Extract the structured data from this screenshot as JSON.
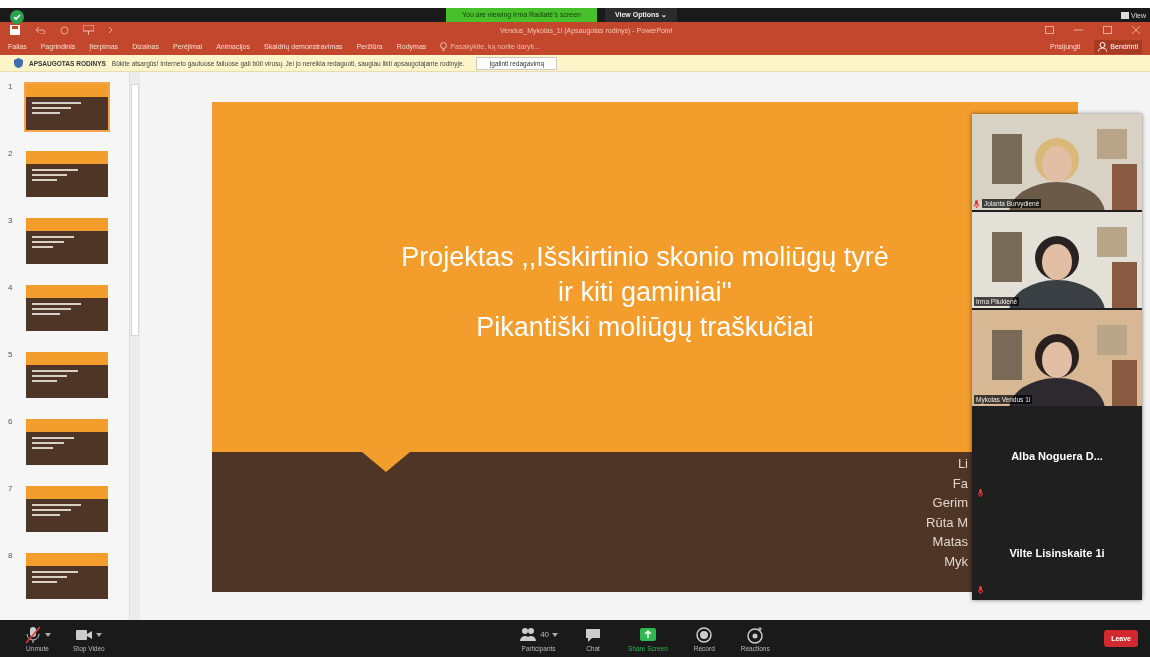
{
  "zoom_top": {
    "banner": "You are viewing Irma Radiatė's screen",
    "view_options": "View Options ⌄",
    "view": "View"
  },
  "window": {
    "title": "Vendus_Mykolas_1i (Apsaugotas rodinys) - PowerPoint"
  },
  "ribbon": {
    "tabs": [
      "Failas",
      "Pagrindinis",
      "Įterpimas",
      "Dizainas",
      "Perėjimai",
      "Animacijos",
      "Skaidrių demonstravimas",
      "Peržiūra",
      "Rodymas"
    ],
    "tell_me": "Pasakykite, ką norite daryti...",
    "sign_in": "Prisijungti",
    "share": "Bendrinti"
  },
  "protected_view": {
    "label": "APSAUGOTAS RODINYS",
    "message": "Būkite atsargūs! Interneto gautuose failuose gali būti virusų. Jei jo nereikia redaguoti, saugiau likti apsaugotajame rodinyje.",
    "button": "Įgalinti redagavimą"
  },
  "slides": [
    {
      "number": "1",
      "selected": true
    },
    {
      "number": "2",
      "selected": false
    },
    {
      "number": "3",
      "selected": false
    },
    {
      "number": "4",
      "selected": false
    },
    {
      "number": "5",
      "selected": false
    },
    {
      "number": "6",
      "selected": false
    },
    {
      "number": "7",
      "selected": false
    },
    {
      "number": "8",
      "selected": false
    }
  ],
  "current_slide": {
    "title_lines": [
      "Projektas ,,Išskirtinio skonio moliūgų tyrė",
      "ir kiti gaminiai''",
      "Pikantiški moliūgų traškučiai"
    ],
    "authors": [
      "Li",
      "Fa",
      "Gerim",
      "Rūta M",
      "Matas",
      "Myk"
    ]
  },
  "participants": [
    {
      "name": "Jolanta Burvydienė",
      "kind": "video",
      "muted": true
    },
    {
      "name": "Irma Pilukienė",
      "kind": "video",
      "muted": false
    },
    {
      "name": "Mykolas Vendus 1i",
      "kind": "video",
      "muted": false
    },
    {
      "name": "Alba Noguera D...",
      "kind": "name",
      "muted": true
    },
    {
      "name": "Vilte Lisinskaite 1i",
      "kind": "name",
      "muted": true
    }
  ],
  "toolbar": {
    "left": [
      {
        "label": "Unmute",
        "kind": "mic"
      },
      {
        "label": "Stop Video",
        "kind": "camera"
      }
    ],
    "center": [
      {
        "label": "Participants",
        "kind": "people",
        "count": "40"
      },
      {
        "label": "Chat",
        "kind": "chat"
      },
      {
        "label": "Share Screen",
        "kind": "share"
      },
      {
        "label": "Record",
        "kind": "record"
      },
      {
        "label": "Reactions",
        "kind": "reactions"
      }
    ],
    "leave": "Leave"
  }
}
